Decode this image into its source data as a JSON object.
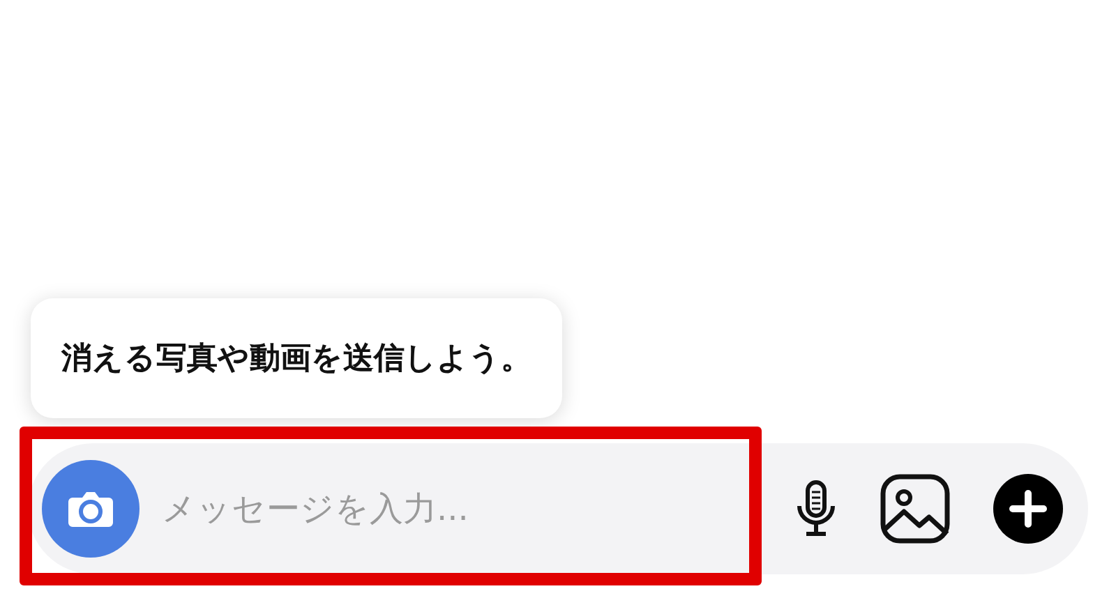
{
  "tooltip": {
    "text": "消える写真や動画を送信しよう。"
  },
  "composer": {
    "placeholder": "メッセージを入力...",
    "buttons": [
      {
        "kind": "mic"
      },
      {
        "kind": "image"
      },
      {
        "kind": "plus"
      }
    ]
  },
  "highlight": {
    "shown": true
  }
}
